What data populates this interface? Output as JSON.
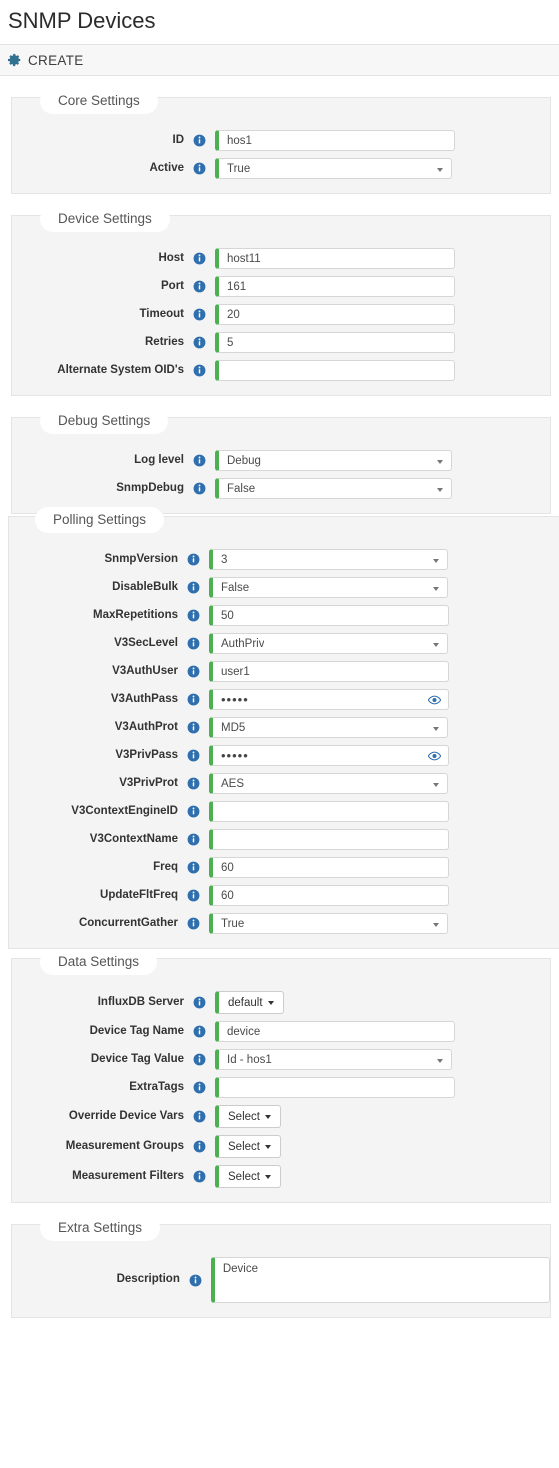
{
  "header": {
    "title": "SNMP Devices",
    "toolbar": {
      "create_label": "CREATE",
      "gear_icon": "gear-icon"
    }
  },
  "icons": {
    "info": "info-icon",
    "eye": "eye-icon",
    "caret": "chevron-down-icon"
  },
  "colors": {
    "accent_green": "#4caf50",
    "info_blue": "#2f6fad",
    "panel_bg": "#f4f4f4",
    "toolbar_bg": "#f7f7f7",
    "gear_teal": "#31708f"
  },
  "sections": [
    {
      "legend": "Core Settings",
      "fields": [
        {
          "label": "ID",
          "type": "text",
          "value": "hos1"
        },
        {
          "label": "Active",
          "type": "select",
          "value": "True"
        }
      ]
    },
    {
      "legend": "Device Settings",
      "fields": [
        {
          "label": "Host",
          "type": "text",
          "value": "host11"
        },
        {
          "label": "Port",
          "type": "text",
          "value": "161"
        },
        {
          "label": "Timeout",
          "type": "text",
          "value": "20"
        },
        {
          "label": "Retries",
          "type": "text",
          "value": "5"
        },
        {
          "label": "Alternate System OID's",
          "type": "text",
          "value": ""
        }
      ]
    },
    {
      "legend": "Debug Settings",
      "fields": [
        {
          "label": "Log level",
          "type": "select",
          "value": "Debug"
        },
        {
          "label": "SnmpDebug",
          "type": "select",
          "value": "False"
        }
      ]
    },
    {
      "legend": "Polling Settings",
      "fields": [
        {
          "label": "SnmpVersion",
          "type": "select",
          "value": "3"
        },
        {
          "label": "DisableBulk",
          "type": "select",
          "value": "False"
        },
        {
          "label": "MaxRepetitions",
          "type": "text",
          "value": "50"
        },
        {
          "label": "V3SecLevel",
          "type": "select",
          "value": "AuthPriv"
        },
        {
          "label": "V3AuthUser",
          "type": "text",
          "value": "user1"
        },
        {
          "label": "V3AuthPass",
          "type": "password",
          "value": "•••••"
        },
        {
          "label": "V3AuthProt",
          "type": "select",
          "value": "MD5"
        },
        {
          "label": "V3PrivPass",
          "type": "password",
          "value": "•••••"
        },
        {
          "label": "V3PrivProt",
          "type": "select",
          "value": "AES"
        },
        {
          "label": "V3ContextEngineID",
          "type": "text",
          "value": ""
        },
        {
          "label": "V3ContextName",
          "type": "text",
          "value": ""
        },
        {
          "label": "Freq",
          "type": "text",
          "value": "60"
        },
        {
          "label": "UpdateFltFreq",
          "type": "text",
          "value": "60"
        },
        {
          "label": "ConcurrentGather",
          "type": "select",
          "value": "True"
        }
      ]
    },
    {
      "legend": "Data Settings",
      "fields": [
        {
          "label": "InfluxDB Server",
          "type": "dropdown-button",
          "value": "default"
        },
        {
          "label": "Device Tag Name",
          "type": "text",
          "value": "device"
        },
        {
          "label": "Device Tag Value",
          "type": "select",
          "value": "Id - hos1"
        },
        {
          "label": "ExtraTags",
          "type": "text",
          "value": ""
        },
        {
          "label": "Override Device Vars",
          "type": "dropdown-button",
          "value": "Select"
        },
        {
          "label": "Measurement Groups",
          "type": "dropdown-button",
          "value": "Select"
        },
        {
          "label": "Measurement Filters",
          "type": "dropdown-button",
          "value": "Select"
        }
      ]
    },
    {
      "legend": "Extra Settings",
      "fields": [
        {
          "label": "Description",
          "type": "textarea",
          "value": "Device"
        }
      ]
    }
  ]
}
